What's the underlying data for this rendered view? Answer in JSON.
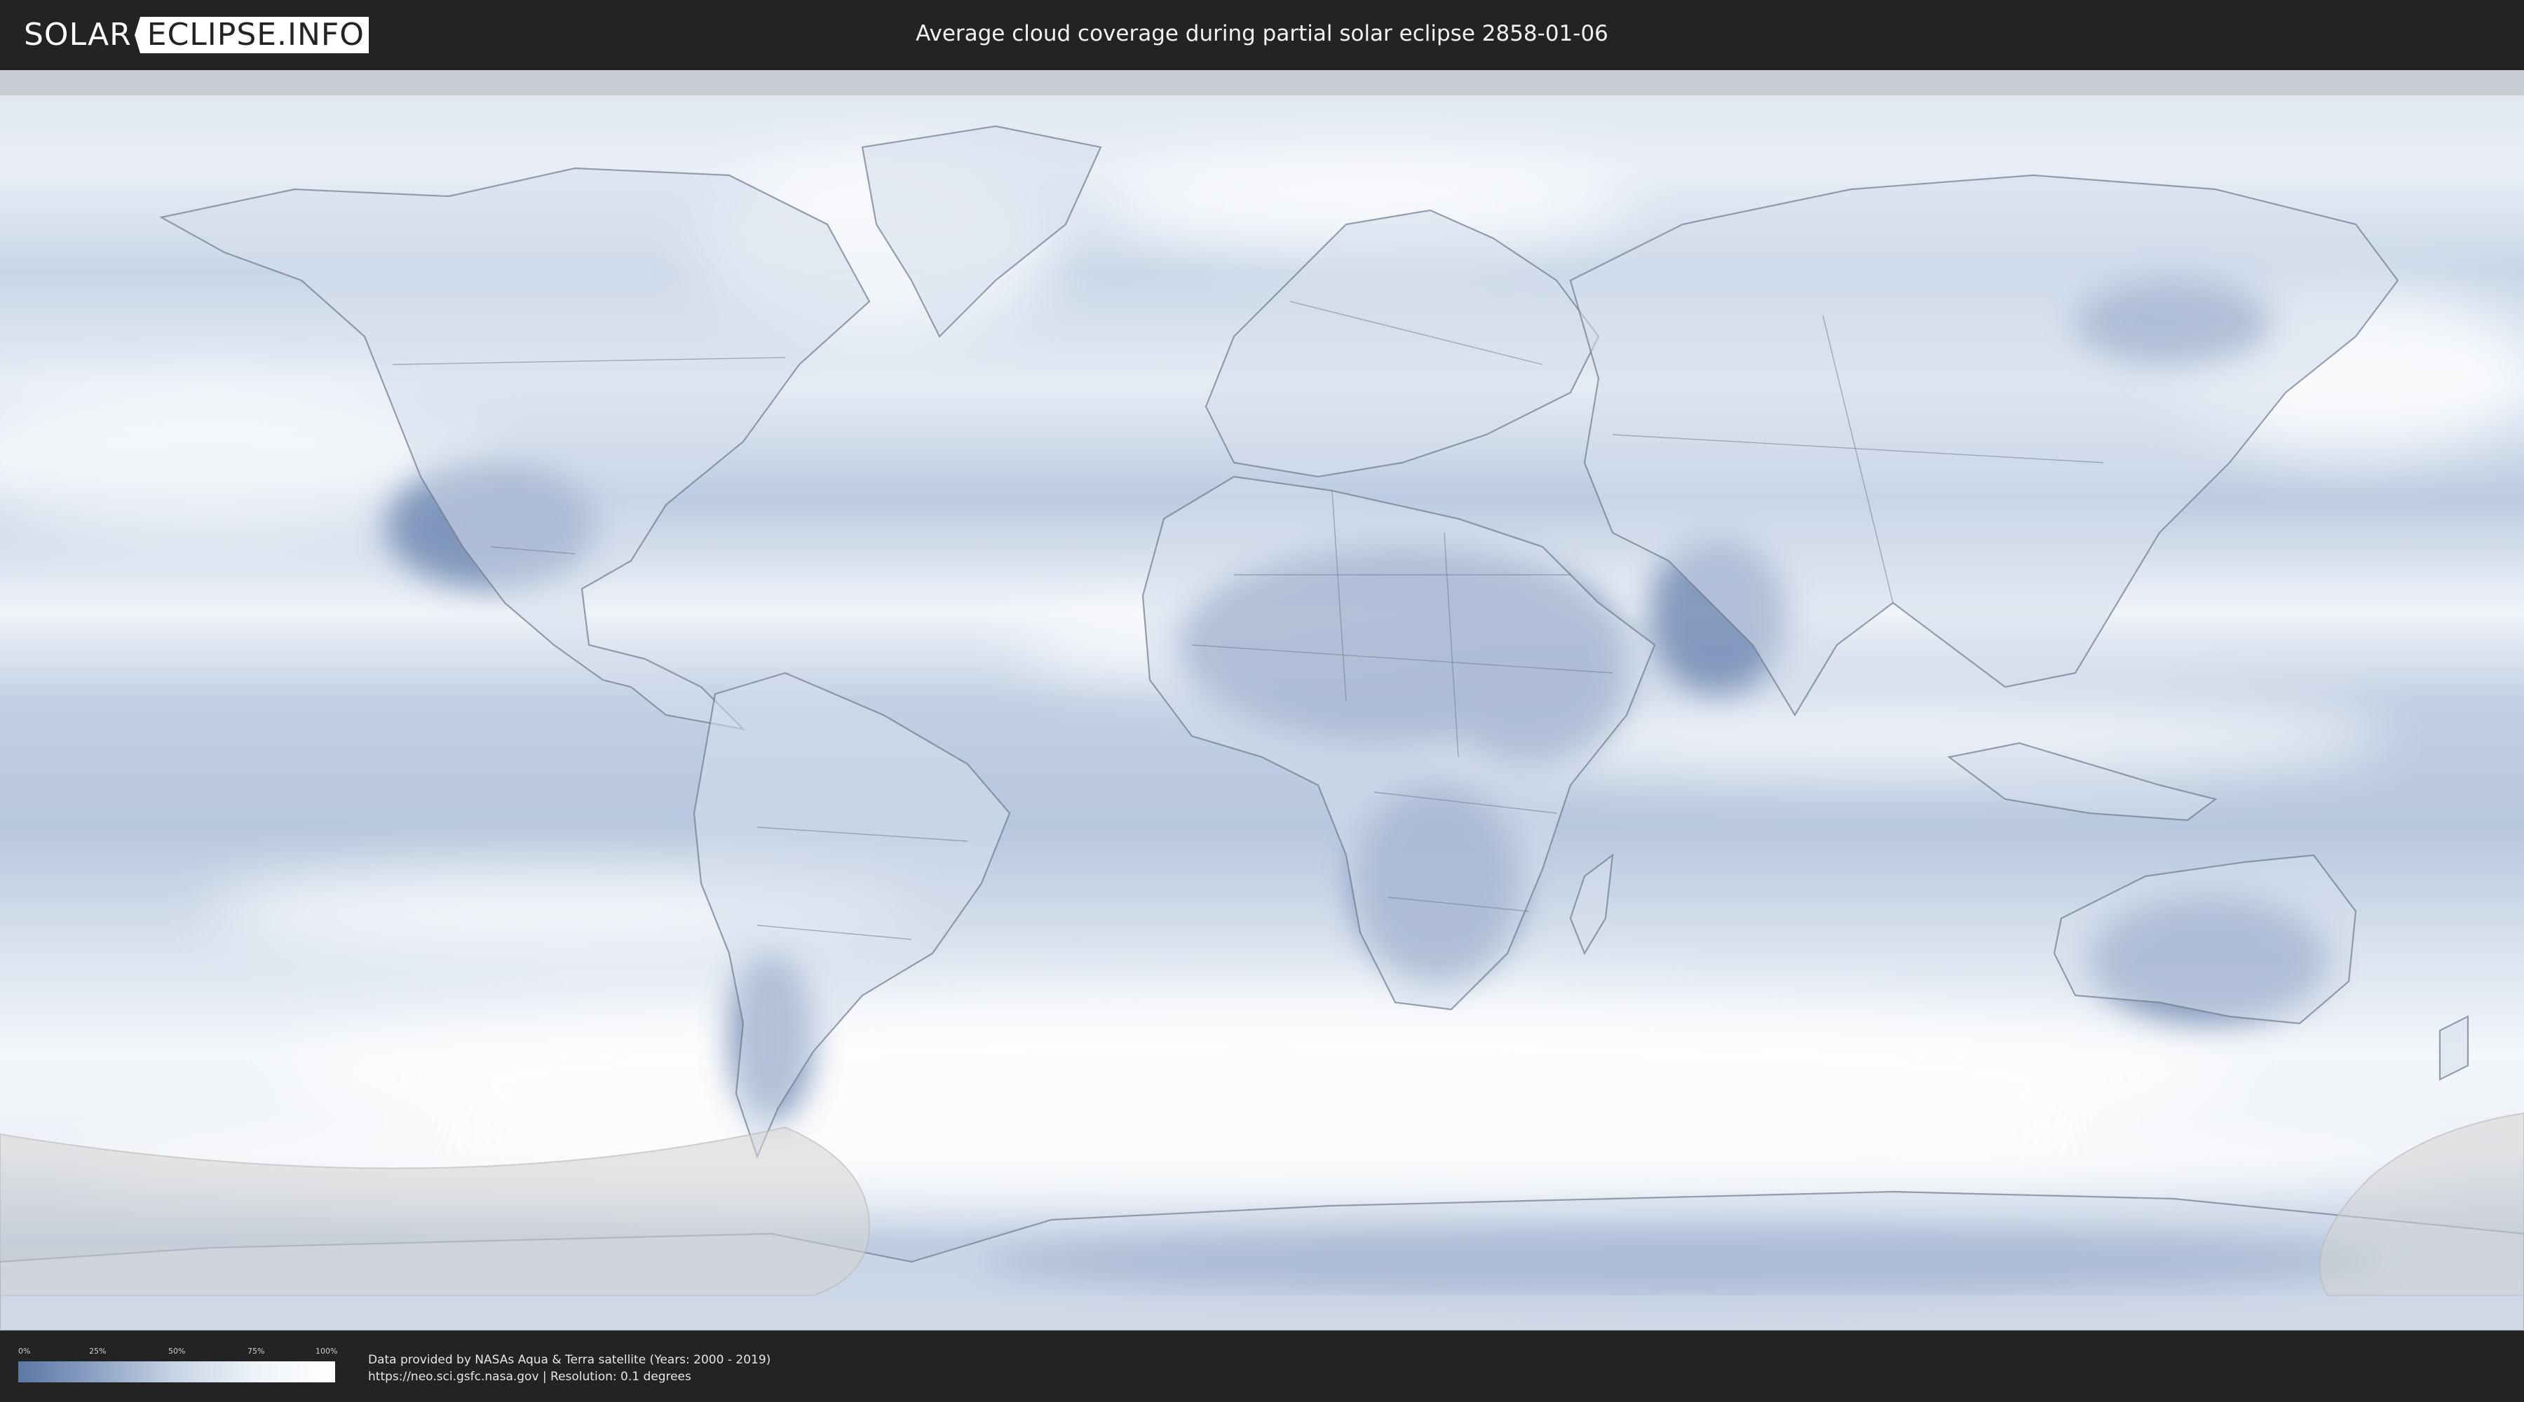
{
  "header": {
    "logo": {
      "left": "SOLAR",
      "right": "ECLIPSE.INFO"
    },
    "title": "Average cloud coverage during partial solar eclipse 2858-01-06"
  },
  "map": {
    "projection": "equirectangular",
    "colors": {
      "ocean_base": "#c7d4e7",
      "clear_sky": "#5b77a5",
      "full_cloud": "#ffffff",
      "borders": "#6d7a8c",
      "eclipse_zone": "#d3d3d3"
    }
  },
  "legend": {
    "ticks": [
      "0%",
      "25%",
      "50%",
      "75%",
      "100%"
    ],
    "gradient": [
      "#5b77a5",
      "#8ea3c5",
      "#c9d5e6",
      "#eef2f8",
      "#ffffff"
    ]
  },
  "footer": {
    "credit_line_1": "Data provided by NASAs Aqua & Terra satellite (Years: 2000 - 2019)",
    "credit_line_2": "https://neo.sci.gsfc.nasa.gov | Resolution: 0.1 degrees"
  }
}
